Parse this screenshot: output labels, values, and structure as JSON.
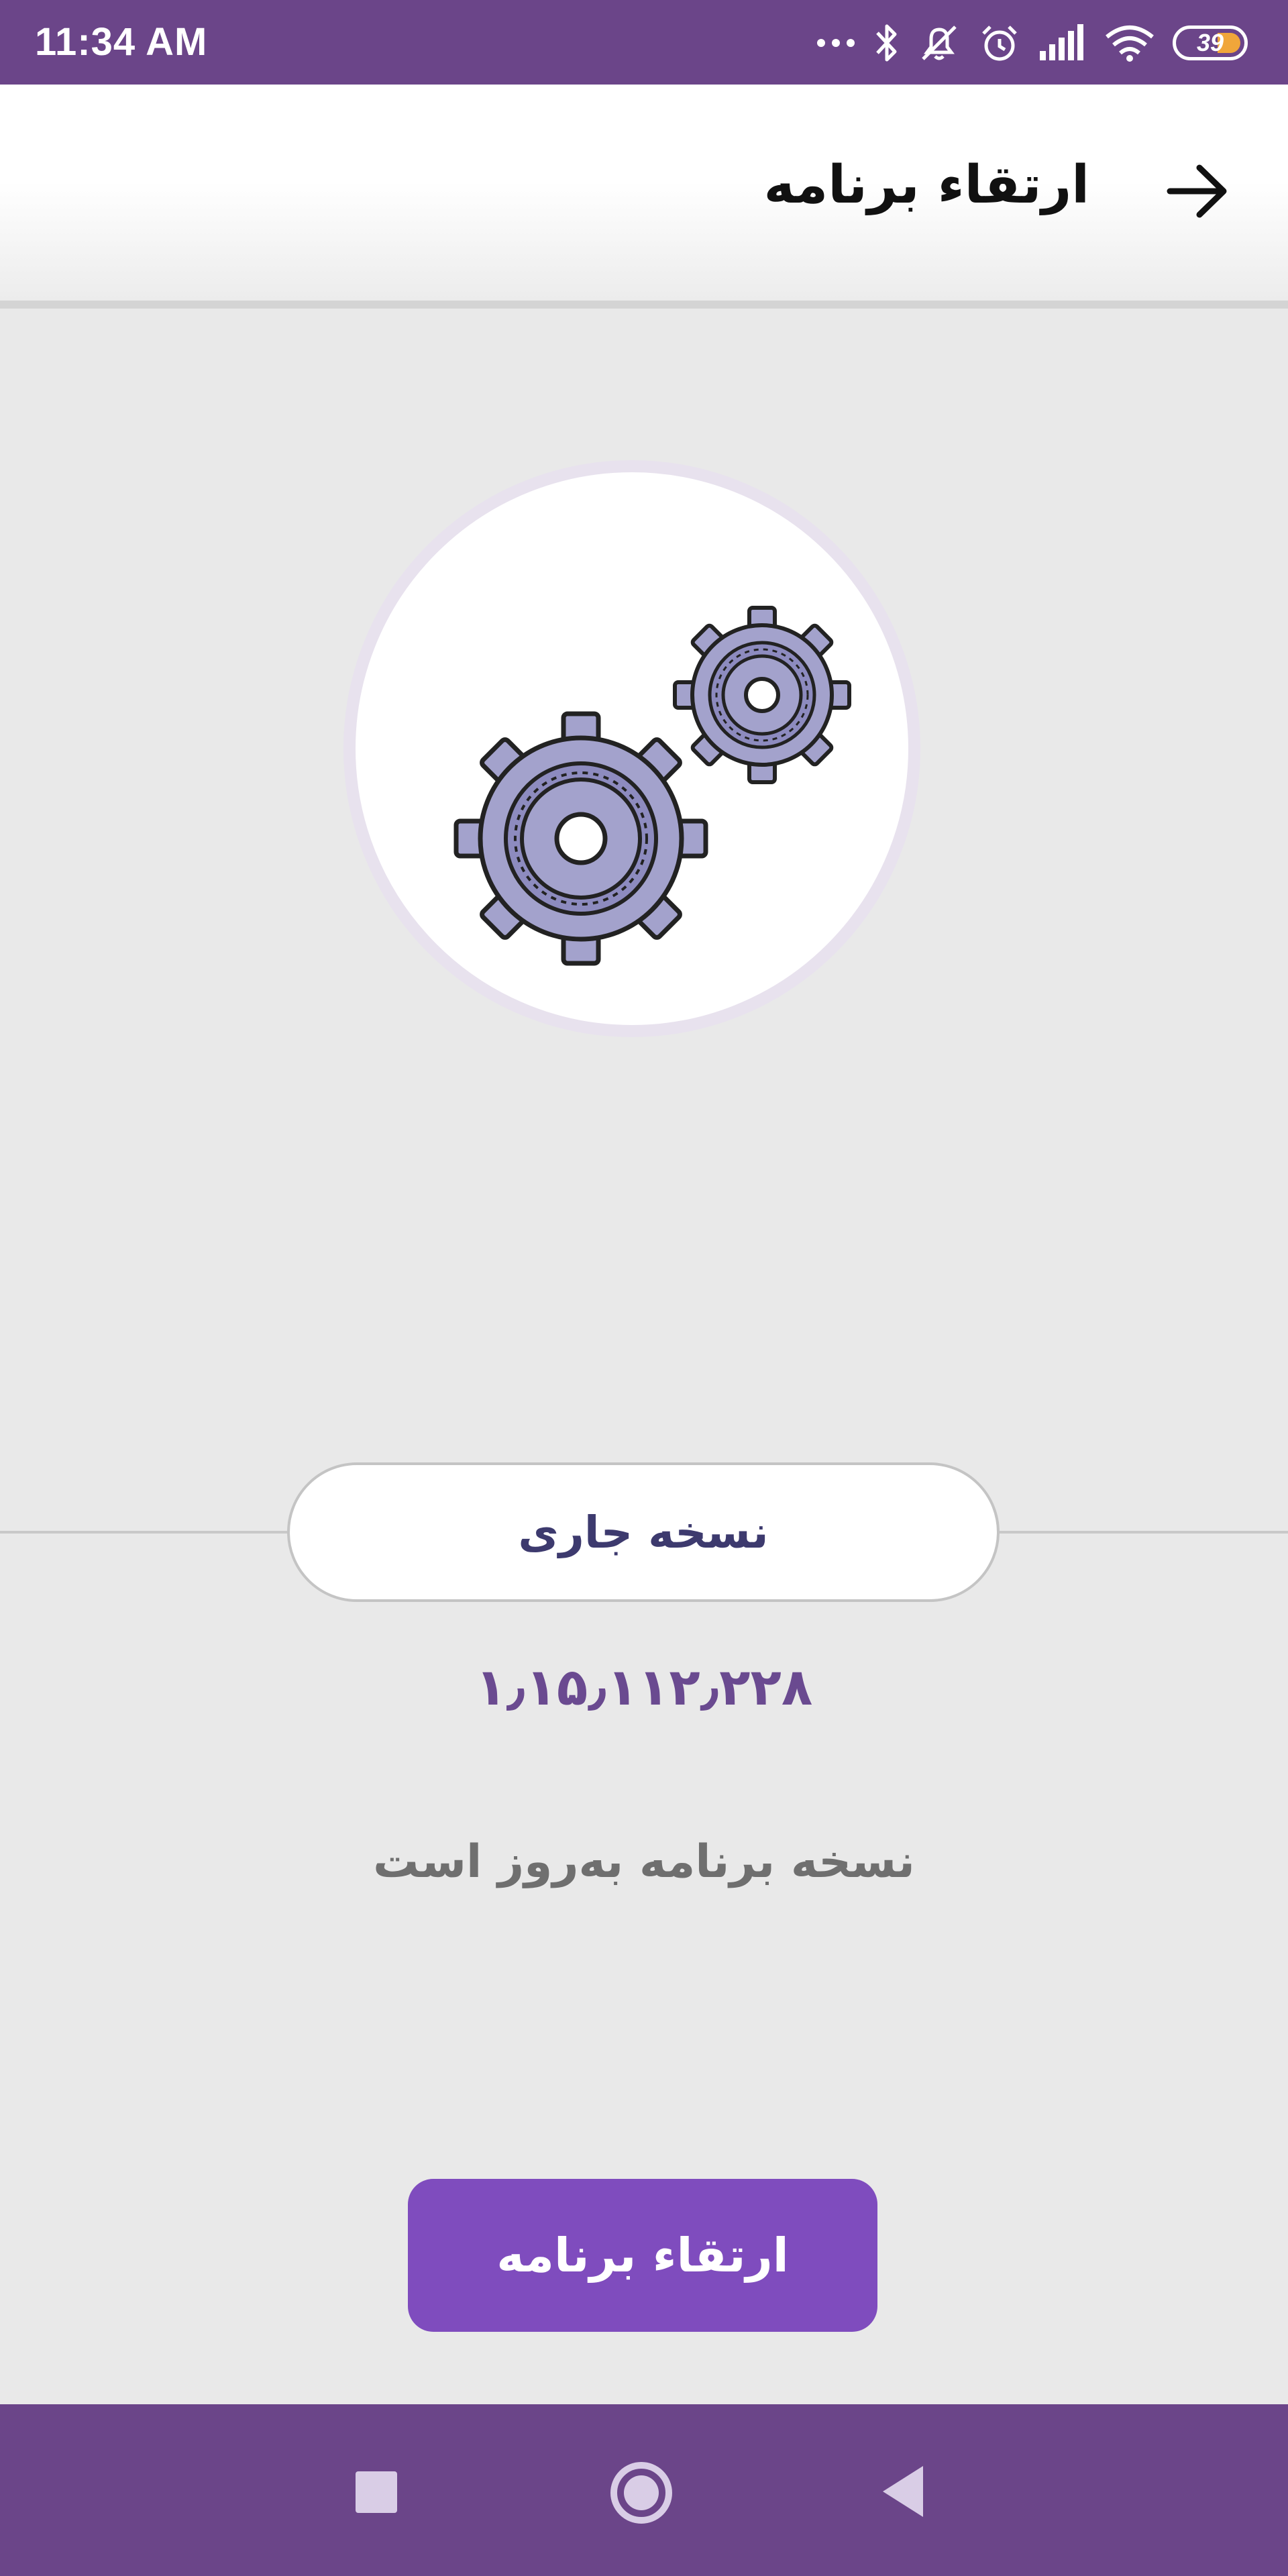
{
  "status_bar": {
    "time": "11:34 AM",
    "battery_level": "39",
    "icons": [
      "more-dots-icon",
      "bluetooth-icon",
      "notifications-off-icon",
      "alarm-icon",
      "signal-icon",
      "wifi-icon",
      "battery-icon"
    ],
    "color": "#6b4589"
  },
  "app_bar": {
    "title": "ارتقاء برنامه",
    "back_icon": "arrow-right-icon"
  },
  "illustration": {
    "icon": "gears-icon"
  },
  "version": {
    "label": "نسخه جاری",
    "number": "۱٫۱۵٫۱۱۲٫۲۲۸"
  },
  "status_message": "نسخه برنامه به‌روز است",
  "upgrade_button": {
    "label": "ارتقاء برنامه",
    "color": "#7f4cbe"
  },
  "navigation_bar": {
    "buttons": [
      "recents-icon",
      "home-icon",
      "back-triangle-icon"
    ],
    "color": "#6b4589"
  }
}
